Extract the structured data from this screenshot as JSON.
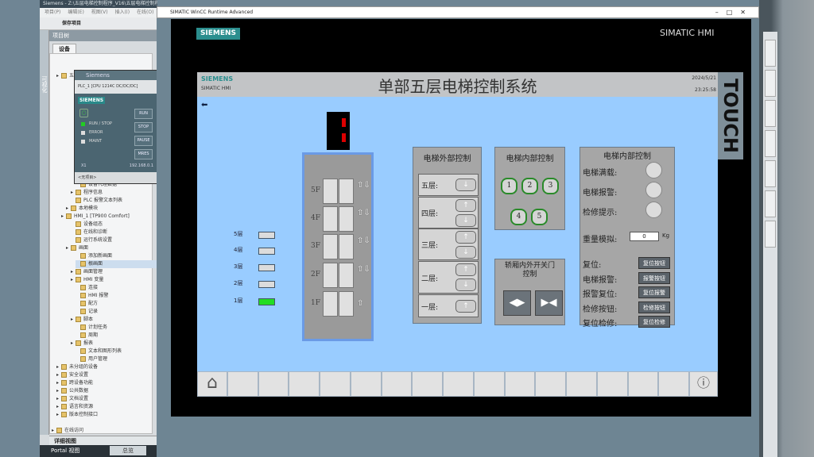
{
  "tia": {
    "title": "Siemens - Z:\\五层电梯控制程序_V16\\五层电梯控制程序_V16",
    "menu": [
      "项目(P)",
      "编辑(E)",
      "视图(V)",
      "插入(I)",
      "在线(O)"
    ],
    "save": "保存项目",
    "side_label": "可视化",
    "tree_title": "项目树",
    "tab": "设备",
    "tree": [
      "五层电梯控制程序",
      "设备代理数据",
      "程序信息",
      "PLC 报警文本列表",
      "本地模块",
      "HMI_1 [TP900 Comfort]",
      "设备组态",
      "在线和诊断",
      "运行系统设置",
      "画面",
      "添加新画面",
      "根画面",
      "画面管理",
      "HMI 变量",
      "连接",
      "HMI 报警",
      "配方",
      "记录",
      "脚本",
      "计划任务",
      "周期",
      "报表",
      "文本和图形列表",
      "用户管理",
      "未分组的设备",
      "安全设置",
      "跨设备功能",
      "公共数据",
      "文档设置",
      "语言和资源",
      "版本控制接口",
      "在线访问"
    ],
    "detail": "详细视图",
    "portal": "Portal 视图",
    "overview": "总览"
  },
  "plc": {
    "title": "Siemens",
    "cpu": "PLC_1 [CPU 1214C DC/DC/DC]",
    "logo": "SIEMENS",
    "leds": [
      "RUN / STOP",
      "ERROR",
      "MAINT"
    ],
    "buttons": [
      "RUN",
      "STOP",
      "PAUSE",
      "MRES"
    ],
    "port": "X1",
    "ip": "192.168.0.1",
    "project": "<无项目>"
  },
  "runtime": {
    "title": "SIMATIC WinCC Runtime Advanced",
    "logo": "SIEMENS",
    "brand": "SIMATIC HMI",
    "touch": "TOUCH"
  },
  "screen": {
    "logo": "SIEMENS",
    "sub": "SIMATIC HMI",
    "title": "单部五层电梯控制系统",
    "date": "2024/5/21",
    "time": "23:25:58",
    "back": "⬅",
    "floors": [
      {
        "label": "5层",
        "active": false
      },
      {
        "label": "4层",
        "active": false
      },
      {
        "label": "3层",
        "active": false
      },
      {
        "label": "2层",
        "active": false
      },
      {
        "label": "1层",
        "active": true
      }
    ],
    "shaft": [
      {
        "label": "5F",
        "arrows": "⇧⇩"
      },
      {
        "label": "4F",
        "arrows": "⇧⇩"
      },
      {
        "label": "3F",
        "arrows": "⇧⇩"
      },
      {
        "label": "2F",
        "arrows": "⇧⇩"
      },
      {
        "label": "1F",
        "arrows": "⇧"
      }
    ],
    "external": {
      "title": "电梯外部控制",
      "rows": [
        "五层:",
        "四层:",
        "三层:",
        "二层:",
        "一层:"
      ],
      "up": "↑",
      "down": "↓"
    },
    "internal": {
      "title": "电梯内部控制",
      "buttons": [
        "1",
        "2",
        "3",
        "4",
        "5"
      ]
    },
    "door": {
      "title": "轿厢内外开关门控制",
      "open": "◀▶",
      "close": "▶◀"
    },
    "status": {
      "title": "电梯内部控制",
      "lamps": [
        "电梯满载:",
        "电梯报警:",
        "检修提示:"
      ],
      "weight_label": "重量模拟:",
      "weight_value": "0",
      "weight_unit": "Kg",
      "actions": [
        {
          "label": "复位:",
          "button": "复位按钮"
        },
        {
          "label": "电梯报警:",
          "button": "报警按钮"
        },
        {
          "label": "报警复位:",
          "button": "复位报警"
        },
        {
          "label": "检修按钮:",
          "button": "检修按钮"
        },
        {
          "label": "复位检修:",
          "button": "复位检修"
        }
      ]
    },
    "home": "⌂",
    "info": "ⓘ"
  },
  "colors": {
    "screen_bg": "#99ccff",
    "active_floor": "#22dd22",
    "brand": "#2b8e8e"
  }
}
